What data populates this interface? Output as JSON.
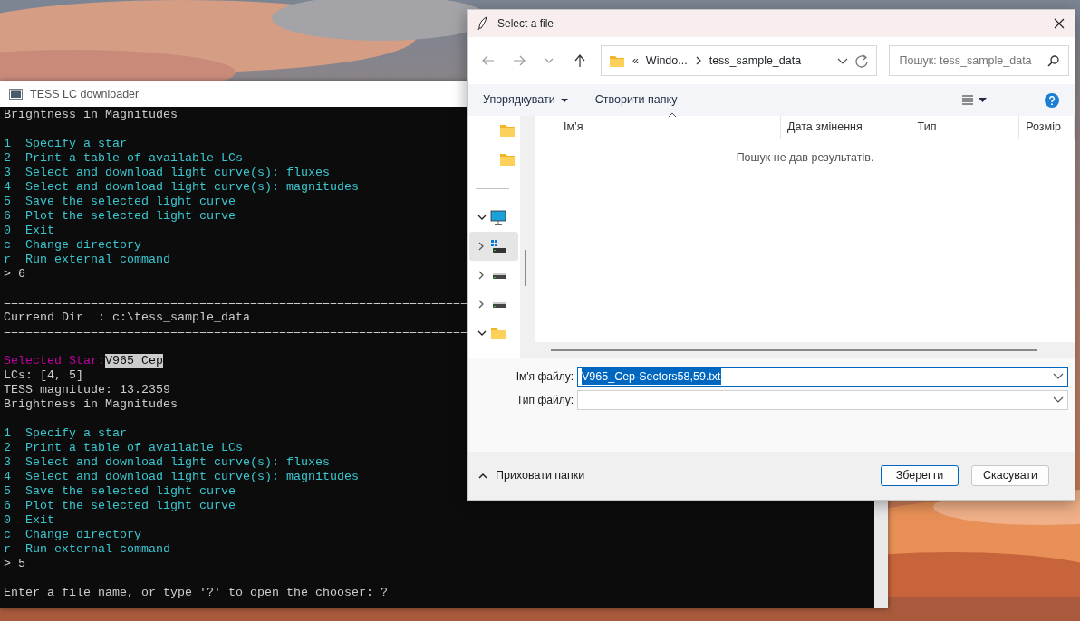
{
  "console_window": {
    "title": "TESS LC downloader",
    "lines": [
      {
        "kind": "text",
        "text": "Brightness in Magnitudes"
      },
      {
        "kind": "blank"
      },
      {
        "kind": "menu",
        "text": "1  Specify a star"
      },
      {
        "kind": "menu",
        "text": "2  Print a table of available LCs"
      },
      {
        "kind": "menu",
        "text": "3  Select and download light curve(s): fluxes"
      },
      {
        "kind": "menu",
        "text": "4  Select and download light curve(s): magnitudes"
      },
      {
        "kind": "menu",
        "text": "5  Save the selected light curve"
      },
      {
        "kind": "menu",
        "text": "6  Plot the selected light curve"
      },
      {
        "kind": "menu",
        "text": "0  Exit"
      },
      {
        "kind": "menu",
        "text": "c  Change directory"
      },
      {
        "kind": "menu",
        "text": "r  Run external command"
      },
      {
        "kind": "text",
        "text": "> 6"
      },
      {
        "kind": "blank"
      },
      {
        "kind": "text",
        "text": "================================================================"
      },
      {
        "kind": "text",
        "text": "Currend Dir  : c:\\tess_sample_data"
      },
      {
        "kind": "text",
        "text": "================================================================"
      },
      {
        "kind": "blank"
      },
      {
        "kind": "star",
        "label": "Selected Star:",
        "value": "V965 Cep"
      },
      {
        "kind": "text",
        "text": "LCs: [4, 5]"
      },
      {
        "kind": "text",
        "text": "TESS magnitude: 13.2359"
      },
      {
        "kind": "text",
        "text": "Brightness in Magnitudes"
      },
      {
        "kind": "blank"
      },
      {
        "kind": "menu",
        "text": "1  Specify a star"
      },
      {
        "kind": "menu",
        "text": "2  Print a table of available LCs"
      },
      {
        "kind": "menu",
        "text": "3  Select and download light curve(s): fluxes"
      },
      {
        "kind": "menu",
        "text": "4  Select and download light curve(s): magnitudes"
      },
      {
        "kind": "menu",
        "text": "5  Save the selected light curve"
      },
      {
        "kind": "menu",
        "text": "6  Plot the selected light curve"
      },
      {
        "kind": "menu",
        "text": "0  Exit"
      },
      {
        "kind": "menu",
        "text": "c  Change directory"
      },
      {
        "kind": "menu",
        "text": "r  Run external command"
      },
      {
        "kind": "text",
        "text": "> 5"
      },
      {
        "kind": "blank"
      },
      {
        "kind": "text",
        "text": "Enter a file name, or type '?' to open the chooser: ?"
      }
    ]
  },
  "file_dialog": {
    "title": "Select a file",
    "address": {
      "overflow_mark": "«",
      "crumbs": [
        "Windo...",
        "tess_sample_data"
      ]
    },
    "search": {
      "placeholder": "Пошук: tess_sample_data"
    },
    "commands": [
      {
        "label": "Упорядкувати",
        "dropdown": true
      },
      {
        "label": "Створити папку",
        "dropdown": false
      }
    ],
    "nav_items": [
      {
        "kind": "folder"
      },
      {
        "kind": "folder"
      },
      {
        "kind": "divider"
      },
      {
        "kind": "computer",
        "expanded": true,
        "selected": false
      },
      {
        "kind": "system-drive",
        "expanded": false,
        "selected": true
      },
      {
        "kind": "drive",
        "expanded": false,
        "selected": false
      },
      {
        "kind": "drive",
        "expanded": false,
        "selected": false
      },
      {
        "kind": "folder",
        "expanded": true,
        "selected": false
      }
    ],
    "columns": [
      {
        "label": "Ім’я",
        "sorted": true
      },
      {
        "label": "Дата змінення",
        "sorted": false
      },
      {
        "label": "Тип",
        "sorted": false
      },
      {
        "label": "Розмір",
        "sorted": false
      }
    ],
    "empty_message": "Пошук не дав результатів.",
    "fields": [
      {
        "label": "Ім'я файлу:",
        "value": "V965_Cep-Sectors58,59.txt",
        "focused": true,
        "text_selected": true
      },
      {
        "label": "Тип файлу:",
        "focused": false
      }
    ],
    "toggle": {
      "label": "Приховати папки"
    },
    "buttons": [
      {
        "label": "Зберегти",
        "default": true
      },
      {
        "label": "Скасувати",
        "default": false
      }
    ]
  }
}
